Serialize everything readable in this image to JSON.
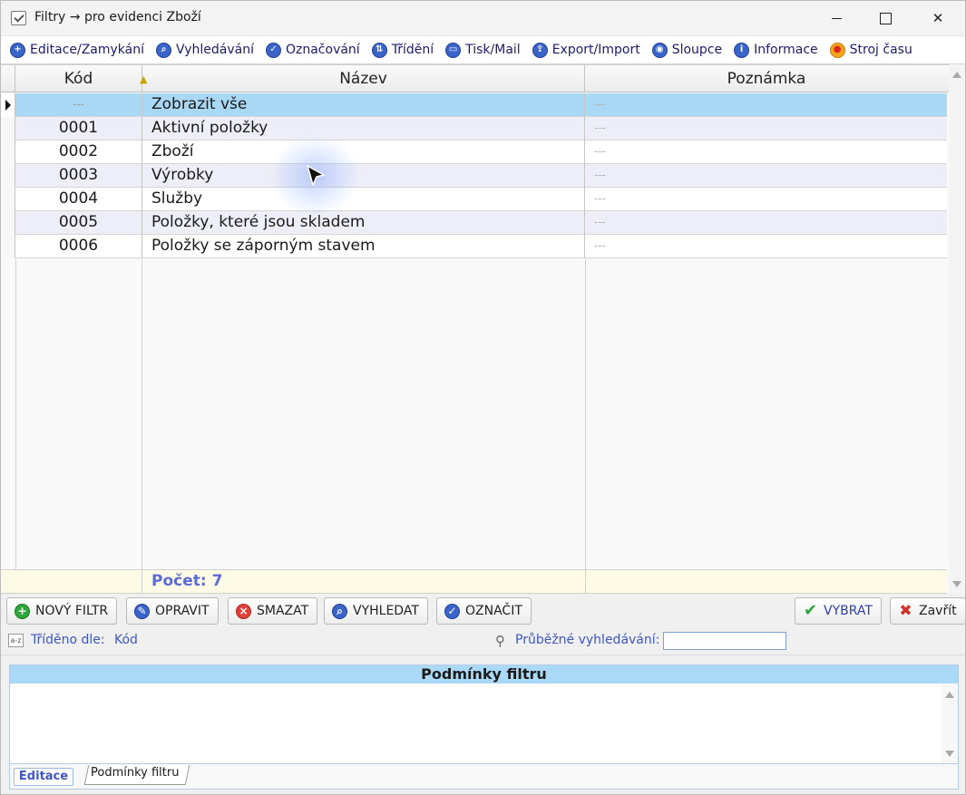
{
  "window": {
    "title": "Filtry → pro evidenci Zboží"
  },
  "menu": [
    {
      "label": "Editace/Zamykání",
      "icon": "plus-icon",
      "glyph": "+"
    },
    {
      "label": "Vyhledávání",
      "icon": "search-icon",
      "glyph": "⌕"
    },
    {
      "label": "Označování",
      "icon": "check-icon",
      "glyph": "✓"
    },
    {
      "label": "Třídění",
      "icon": "sort-icon",
      "glyph": "⇅"
    },
    {
      "label": "Tisk/Mail",
      "icon": "print-icon",
      "glyph": "▭"
    },
    {
      "label": "Export/Import",
      "icon": "export-icon",
      "glyph": "⇪"
    },
    {
      "label": "Sloupce",
      "icon": "columns-icon",
      "glyph": "◉"
    },
    {
      "label": "Informace",
      "icon": "info-icon",
      "glyph": "i"
    },
    {
      "label": "Stroj času",
      "icon": "time-machine-icon",
      "glyph": "●"
    }
  ],
  "grid": {
    "columns": {
      "kod": "Kód",
      "nazev": "Název",
      "poznamka": "Poznámka"
    },
    "sort_indicator": "▲",
    "rows": [
      {
        "kod": "---",
        "nazev": "Zobrazit vše",
        "poznamka": "---"
      },
      {
        "kod": "0001",
        "nazev": "Aktivní položky",
        "poznamka": "---"
      },
      {
        "kod": "0002",
        "nazev": "Zboží",
        "poznamka": "---"
      },
      {
        "kod": "0003",
        "nazev": "Výrobky",
        "poznamka": "---"
      },
      {
        "kod": "0004",
        "nazev": "Služby",
        "poznamka": "---"
      },
      {
        "kod": "0005",
        "nazev": "Položky, které jsou skladem",
        "poznamka": "---"
      },
      {
        "kod": "0006",
        "nazev": "Položky se záporným stavem",
        "poznamka": "---"
      }
    ],
    "footer_count": "Počet: 7"
  },
  "actions": {
    "novy_filtr": "NOVÝ FILTR",
    "opravit": "OPRAVIT",
    "smazat": "SMAZAT",
    "vyhledat": "VYHLEDAT",
    "oznacit": "OZNAČIT",
    "vybrat": "VYBRAT",
    "zavrit": "Zavřít"
  },
  "status": {
    "sort_icon_text": "a-z",
    "sorted_by_label": "Tříděno dle:",
    "sorted_by_value": "Kód",
    "search_label": "Průběžné vyhledávání:",
    "search_value": ""
  },
  "conditions": {
    "title": "Podmínky filtru",
    "tab_editace": "Editace",
    "tab_podminky": "Podmínky filtru"
  },
  "colors": {
    "selected_row": "#a8d8f4",
    "alt_row": "#eeeef8",
    "accent_text": "#3f56c6",
    "footer_bg": "#fdfbe6"
  }
}
